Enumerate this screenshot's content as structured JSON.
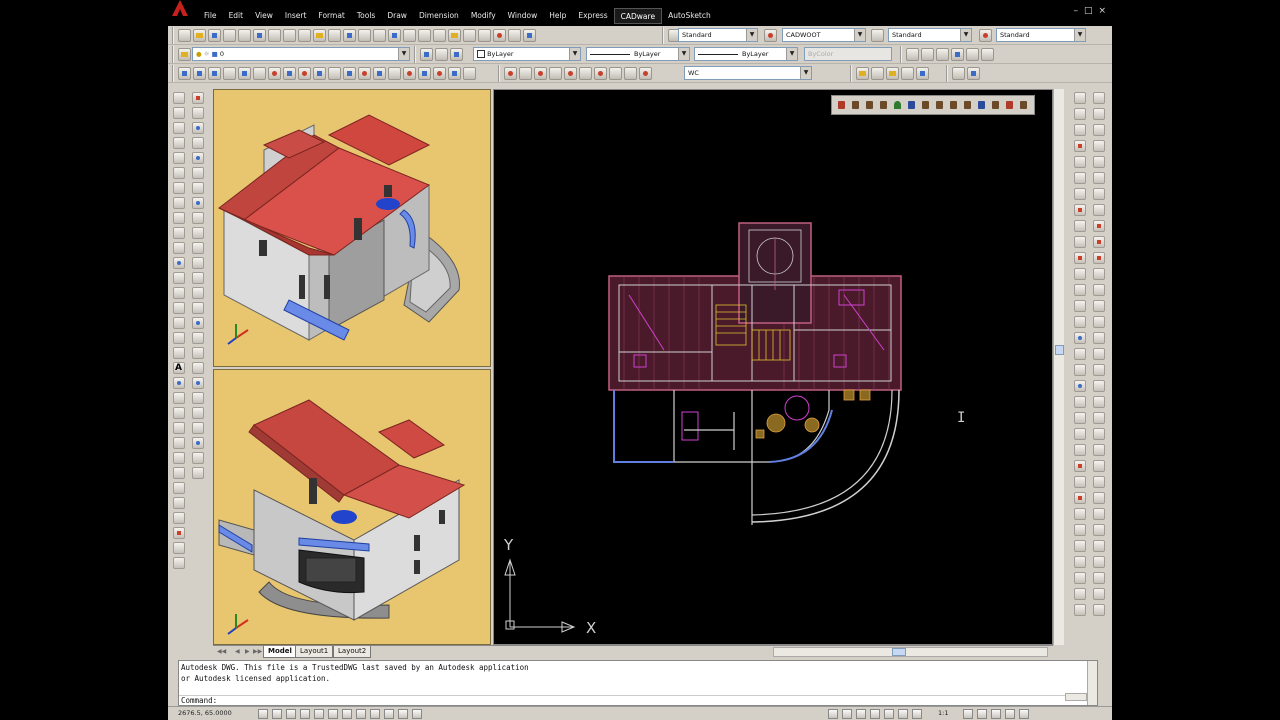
{
  "menu": {
    "items": [
      "File",
      "Edit",
      "View",
      "Insert",
      "Format",
      "Tools",
      "Draw",
      "Dimension",
      "Modify",
      "Window",
      "Help",
      "Express",
      "CADware",
      "AutoSketch"
    ],
    "active_index": 12,
    "window_controls": [
      "–",
      "□",
      "×"
    ]
  },
  "toolbars": {
    "text_style": "Standard",
    "dim_style": "CADWOOT",
    "table_style": "Standard",
    "ml_style": "Standard",
    "layer": "0",
    "color": "ByLayer",
    "linetype": "ByLayer",
    "lineweight": "ByLayer",
    "plotstyle": "ByColor",
    "ucs": "WC"
  },
  "layout_tabs": [
    "Model",
    "Layout1",
    "Layout2"
  ],
  "axis_labels": {
    "y": "Y",
    "x": "X"
  },
  "command": {
    "line1": "Autodesk DWG.  This file is a TrustedDWG last saved by an Autodesk application",
    "line2": "or Autodesk licensed application.",
    "prompt": "Command:"
  },
  "status": {
    "coords": "2676.5, 65.0000",
    "scale": "1:1"
  }
}
